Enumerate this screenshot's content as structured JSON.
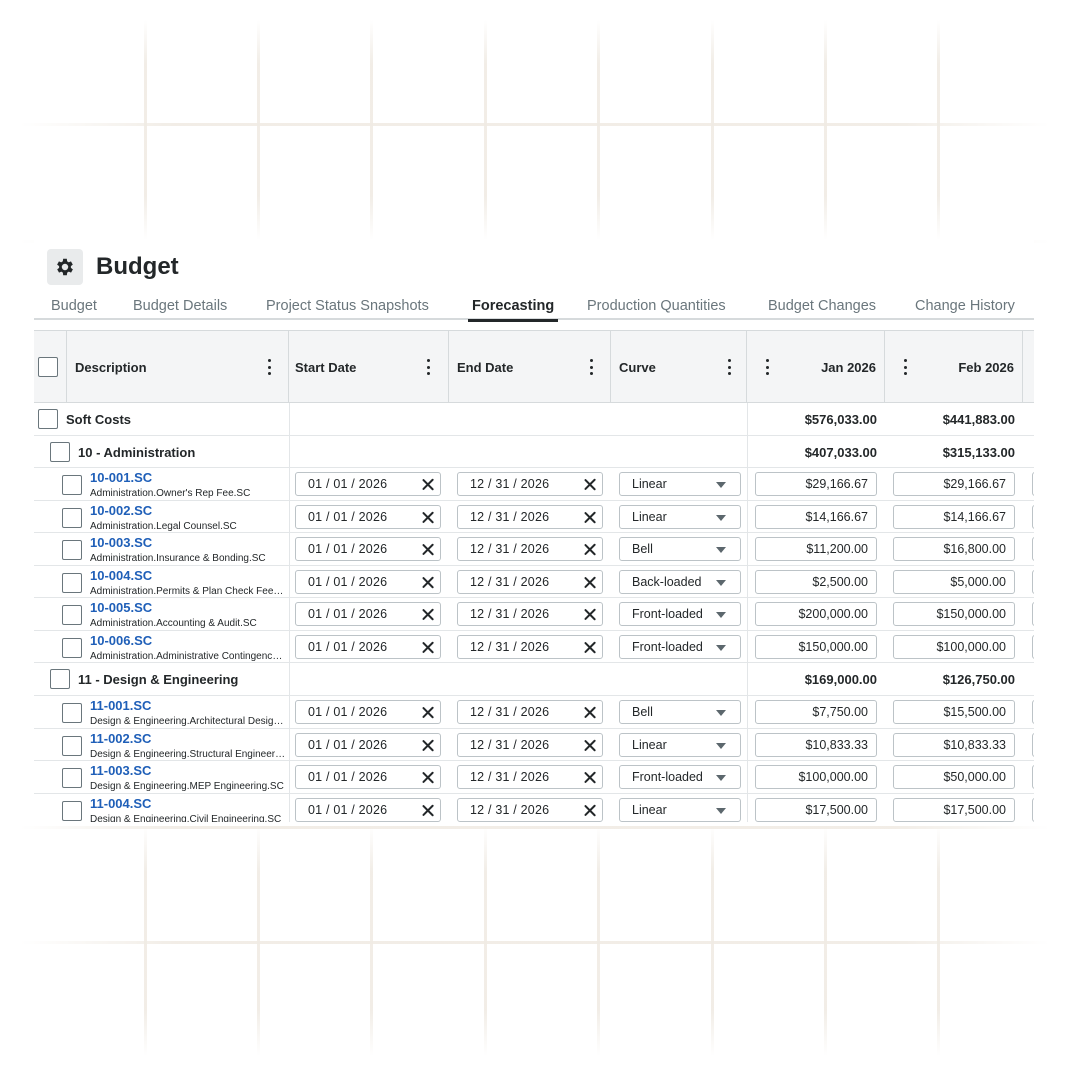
{
  "page": {
    "title": "Budget",
    "icon": "gear-icon"
  },
  "tabs": [
    {
      "label": "Budget",
      "active": false
    },
    {
      "label": "Budget Details",
      "active": false
    },
    {
      "label": "Project Status Snapshots",
      "active": false
    },
    {
      "label": "Forecasting",
      "active": true
    },
    {
      "label": "Production Quantities",
      "active": false
    },
    {
      "label": "Budget Changes",
      "active": false
    },
    {
      "label": "Change History",
      "active": false
    }
  ],
  "columns": {
    "description": "Description",
    "start_date": "Start Date",
    "end_date": "End Date",
    "curve": "Curve",
    "month1": "Jan 2026",
    "month2": "Feb 2026"
  },
  "groups": [
    {
      "label": "Soft Costs",
      "jan": "$576,033.00",
      "feb": "$441,883.00",
      "level": 0
    },
    {
      "label": "10 - Administration",
      "jan": "$407,033.00",
      "feb": "$315,133.00",
      "level": 1
    },
    {
      "label": "11 - Design & Engineering",
      "jan": "$169,000.00",
      "feb": "$126,750.00",
      "level": 1
    }
  ],
  "rows": [
    {
      "code": "10-001.SC",
      "desc": "Administration.Owner's Rep Fee.SC",
      "start": "01 / 01 / 2026",
      "end": "12 / 31 / 2026",
      "curve": "Linear",
      "jan": "$29,166.67",
      "feb": "$29,166.67"
    },
    {
      "code": "10-002.SC",
      "desc": "Administration.Legal Counsel.SC",
      "start": "01 / 01 / 2026",
      "end": "12 / 31 / 2026",
      "curve": "Linear",
      "jan": "$14,166.67",
      "feb": "$14,166.67"
    },
    {
      "code": "10-003.SC",
      "desc": "Administration.Insurance & Bonding.SC",
      "start": "01 / 01 / 2026",
      "end": "12 / 31 / 2026",
      "curve": "Bell",
      "jan": "$11,200.00",
      "feb": "$16,800.00"
    },
    {
      "code": "10-004.SC",
      "desc": "Administration.Permits & Plan Check Fees.SC",
      "start": "01 / 01 / 2026",
      "end": "12 / 31 / 2026",
      "curve": "Back-loaded",
      "jan": "$2,500.00",
      "feb": "$5,000.00"
    },
    {
      "code": "10-005.SC",
      "desc": "Administration.Accounting & Audit.SC",
      "start": "01 / 01 / 2026",
      "end": "12 / 31 / 2026",
      "curve": "Front-loaded",
      "jan": "$200,000.00",
      "feb": "$150,000.00"
    },
    {
      "code": "10-006.SC",
      "desc": "Administration.Administrative Contingency.SC",
      "start": "01 / 01 / 2026",
      "end": "12 / 31 / 2026",
      "curve": "Front-loaded",
      "jan": "$150,000.00",
      "feb": "$100,000.00"
    },
    {
      "code": "11-001.SC",
      "desc": "Design & Engineering.Architectural Design.SC",
      "start": "01 / 01 / 2026",
      "end": "12 / 31 / 2026",
      "curve": "Bell",
      "jan": "$7,750.00",
      "feb": "$15,500.00"
    },
    {
      "code": "11-002.SC",
      "desc": "Design & Engineering.Structural Engineering.SC",
      "start": "01 / 01 / 2026",
      "end": "12 / 31 / 2026",
      "curve": "Linear",
      "jan": "$10,833.33",
      "feb": "$10,833.33"
    },
    {
      "code": "11-003.SC",
      "desc": "Design & Engineering.MEP Engineering.SC",
      "start": "01 / 01 / 2026",
      "end": "12 / 31 / 2026",
      "curve": "Front-loaded",
      "jan": "$100,000.00",
      "feb": "$50,000.00"
    },
    {
      "code": "11-004.SC",
      "desc": "Design & Engineering.Civil Engineering.SC",
      "start": "01 / 01 / 2026",
      "end": "12 / 31 / 2026",
      "curve": "Linear",
      "jan": "$17,500.00",
      "feb": "$17,500.00"
    }
  ],
  "colors": {
    "link": "#1f5fb8",
    "header_bg": "#f4f5f6",
    "border": "#d6dadc"
  }
}
